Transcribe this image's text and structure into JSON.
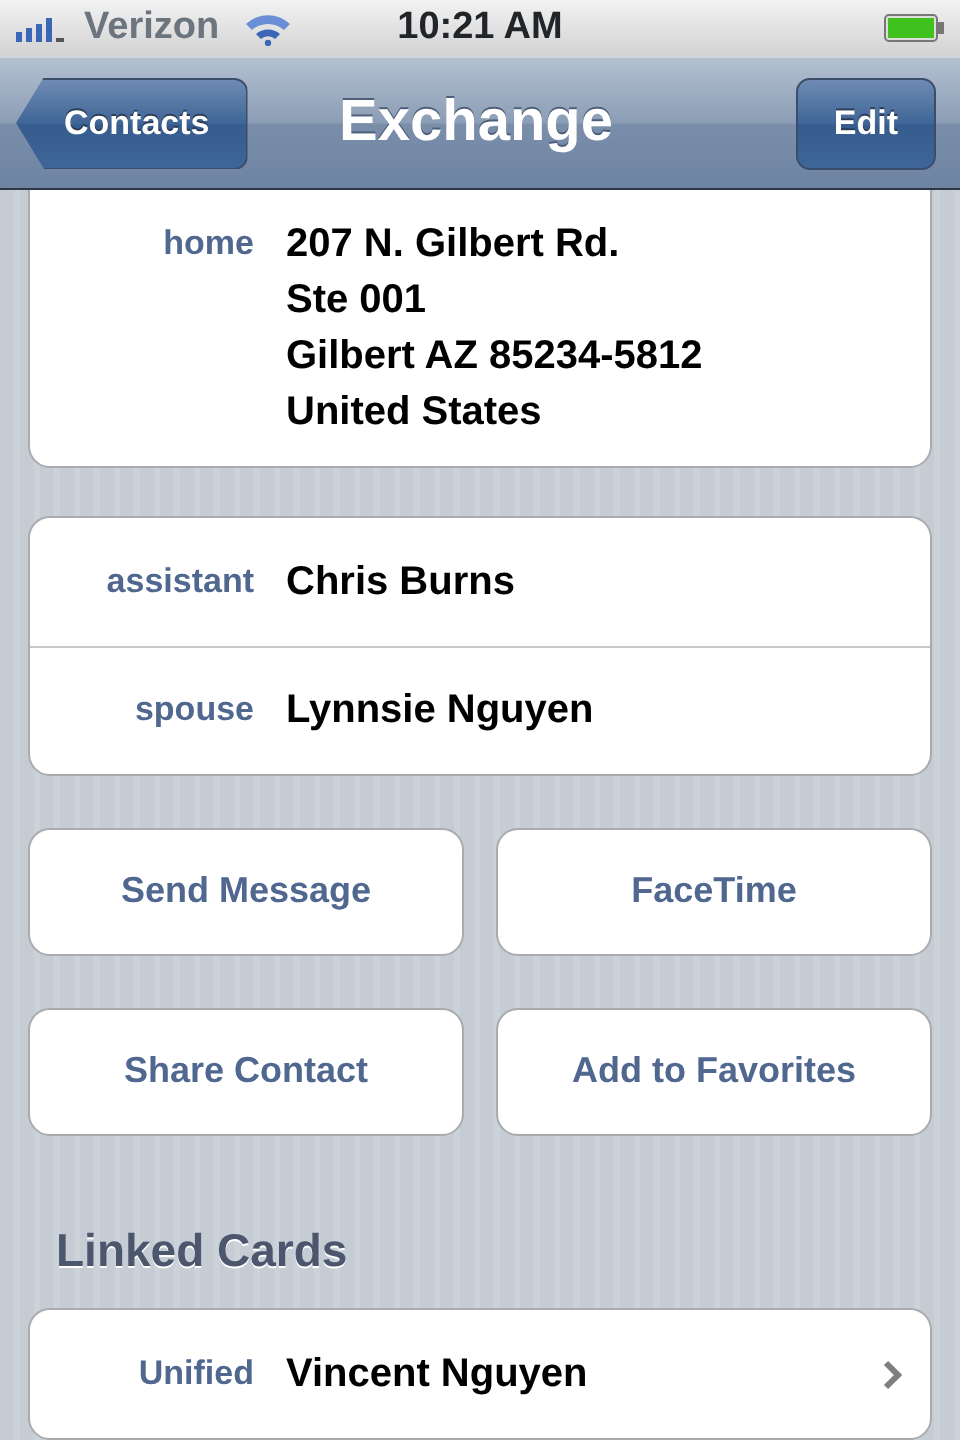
{
  "status_bar": {
    "carrier": "Verizon",
    "time": "10:21 AM"
  },
  "nav_bar": {
    "back": "Contacts",
    "title": "Exchange",
    "action": "Edit"
  },
  "address_card": {
    "label": "home",
    "lines": [
      "207 N. Gilbert Rd.",
      "Ste 001",
      "Gilbert AZ 85234-5812",
      "United States"
    ]
  },
  "relations": [
    {
      "label": "assistant",
      "value": "Chris Burns"
    },
    {
      "label": "spouse",
      "value": "Lynnsie Nguyen"
    }
  ],
  "action_rows": [
    [
      "Send Message",
      "FaceTime"
    ],
    [
      "Share Contact",
      "Add to Favorites"
    ]
  ],
  "linked_cards": {
    "heading": "Linked Cards",
    "items": [
      {
        "label": "Unified",
        "value": "Vincent Nguyen"
      }
    ]
  }
}
